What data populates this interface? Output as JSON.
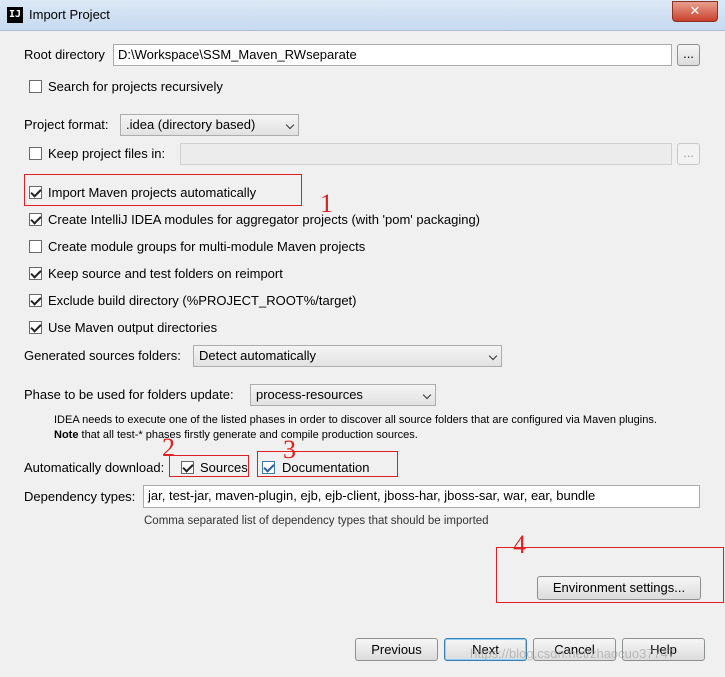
{
  "window": {
    "title": "Import Project",
    "app_icon_text": "IJ",
    "close_glyph": "✕"
  },
  "root_directory": {
    "label": "Root directory",
    "value": "D:\\Workspace\\SSM_Maven_RWseparate",
    "browse_label": "..."
  },
  "search_recursively": {
    "label": "Search for projects recursively",
    "checked": false
  },
  "project_format": {
    "label": "Project format:",
    "value": ".idea (directory based)"
  },
  "keep_project_files": {
    "label": "Keep project files in:",
    "checked": false,
    "value": "",
    "browse_label": "..."
  },
  "options": [
    {
      "label": "Import Maven projects automatically",
      "checked": true
    },
    {
      "label": "Create IntelliJ IDEA modules for aggregator projects (with 'pom' packaging)",
      "checked": true
    },
    {
      "label": "Create module groups for multi-module Maven projects",
      "checked": false
    },
    {
      "label": "Keep source and test folders on reimport",
      "checked": true
    },
    {
      "label": "Exclude build directory (%PROJECT_ROOT%/target)",
      "checked": true
    },
    {
      "label": "Use Maven output directories",
      "checked": true
    }
  ],
  "generated_sources": {
    "label": "Generated sources folders:",
    "value": "Detect automatically"
  },
  "phase": {
    "label": "Phase to be used for folders update:",
    "value": "process-resources",
    "note_line1": "IDEA needs to execute one of the listed phases in order to discover all source folders that are configured via Maven plugins.",
    "note_bold": "Note",
    "note_line2": " that all test-* phases firstly generate and compile production sources."
  },
  "auto_download": {
    "label": "Automatically download:",
    "sources": {
      "label": "Sources",
      "checked": true
    },
    "documentation": {
      "label": "Documentation",
      "checked": true
    }
  },
  "dependency_types": {
    "label": "Dependency types:",
    "value": "jar, test-jar, maven-plugin, ejb, ejb-client, jboss-har, jboss-sar, war, ear, bundle",
    "hint": "Comma separated list of dependency types that should be imported"
  },
  "environment_settings_label": "Environment settings...",
  "annotations": [
    "1",
    "2",
    "3",
    "4"
  ],
  "buttons": {
    "previous": "Previous",
    "next": "Next",
    "cancel": "Cancel",
    "help": "Help"
  },
  "watermark": "https://blog.csdn.net/zhaocuo37747",
  "colors": {
    "annotation_red": "#e02020",
    "accent_blue": "#3c7fb1"
  }
}
